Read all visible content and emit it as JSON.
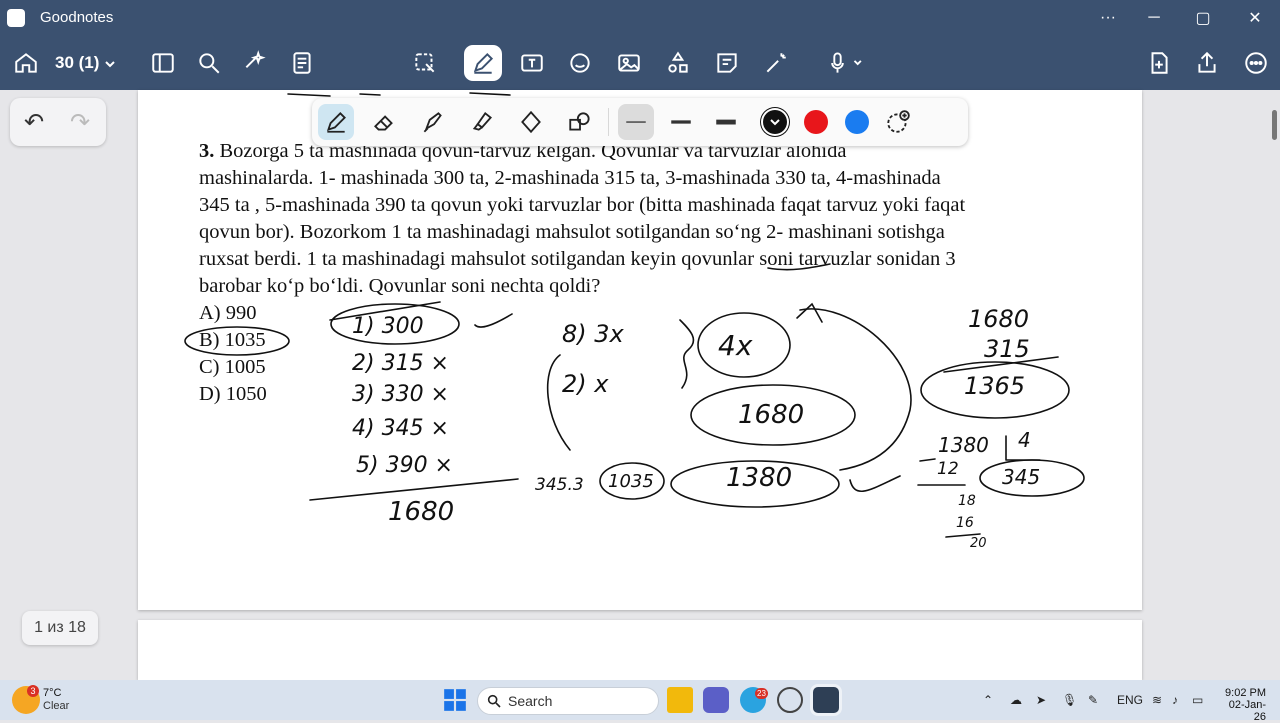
{
  "titlebar": {
    "app_title": "Goodnotes",
    "more": "···",
    "minimize": "─",
    "maximize": "▢",
    "close": "✕"
  },
  "toolbar": {
    "page_selector": "30 (1)"
  },
  "undo_box": {
    "undo": "↶",
    "redo": "↷"
  },
  "pen_colors": [
    "#111111",
    "#e8161b",
    "#1a7cf0"
  ],
  "problem": {
    "number": "3.",
    "line1": "Bozorga 5 ta mashinada qovun-tarvuz kelgan. Qovunlar va tarvuzlar alohida",
    "line2": "mashinalarda. 1- mashinada 300 ta, 2-mashinada 315 ta, 3-mashinada 330 ta, 4-mashinada",
    "line3": "345 ta , 5-mashinada 390 ta qovun yoki tarvuzlar bor (bitta mashinada faqat tarvuz yoki faqat",
    "line4": "qovun bor). Bozorkom 1 ta mashinadagi mahsulot sotilgandan so‘ng 2- mashinani sotishga",
    "line5": "ruxsat berdi. 1 ta mashinadagi mahsulot sotilgandan keyin qovunlar soni tarvuzlar sonidan 3",
    "line6": "barobar ko‘p bo‘ldi. Qovunlar soni nechta qoldi?"
  },
  "answers": [
    "A) 990",
    "B) 1035",
    "C) 1005",
    "D) 1050"
  ],
  "page_counter": "1 из 18",
  "taskbar": {
    "weather_temp": "7°C",
    "weather_cond": "Clear",
    "search": "Search",
    "lang": "ENG",
    "time": "9:02 PM",
    "date": "02-Jan-26",
    "badge": "3",
    "telegram_badge": "23"
  }
}
